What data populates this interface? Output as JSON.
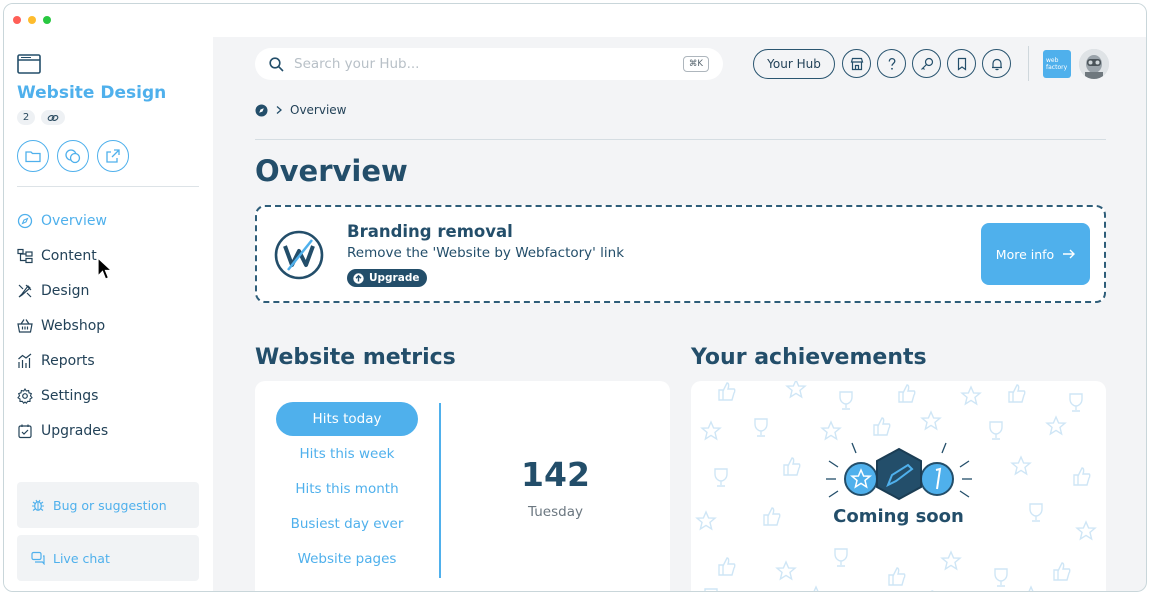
{
  "sidebar": {
    "site_title": "Website Design",
    "page_count": "2",
    "nav": [
      {
        "label": "Overview",
        "icon": "compass-icon",
        "active": true
      },
      {
        "label": "Content",
        "icon": "sitemap-icon"
      },
      {
        "label": "Design",
        "icon": "brush-icon"
      },
      {
        "label": "Webshop",
        "icon": "basket-icon"
      },
      {
        "label": "Reports",
        "icon": "chart-icon"
      },
      {
        "label": "Settings",
        "icon": "gear-icon"
      },
      {
        "label": "Upgrades",
        "icon": "gift-icon"
      }
    ],
    "bug_label": "Bug or suggestion",
    "chat_label": "Live chat"
  },
  "topbar": {
    "search_placeholder": "Search your Hub...",
    "shortcut": "⌘K",
    "hub_label": "Your Hub",
    "logo_text_1": "web",
    "logo_text_2": "factory"
  },
  "breadcrumb": {
    "current": "Overview"
  },
  "page_title": "Overview",
  "promo": {
    "title": "Branding removal",
    "subtitle": "Remove the 'Website by Webfactory' link",
    "badge": "Upgrade",
    "button": "More info"
  },
  "metrics": {
    "title": "Website metrics",
    "tabs": [
      "Hits today",
      "Hits this week",
      "Hits this month",
      "Busiest day ever",
      "Website pages"
    ],
    "value": "142",
    "label": "Tuesday"
  },
  "achievements": {
    "title": "Your achievements",
    "status": "Coming soon"
  },
  "colors": {
    "accent": "#4fb0ec",
    "navy": "#234e6a",
    "background": "#f3f4f6"
  }
}
